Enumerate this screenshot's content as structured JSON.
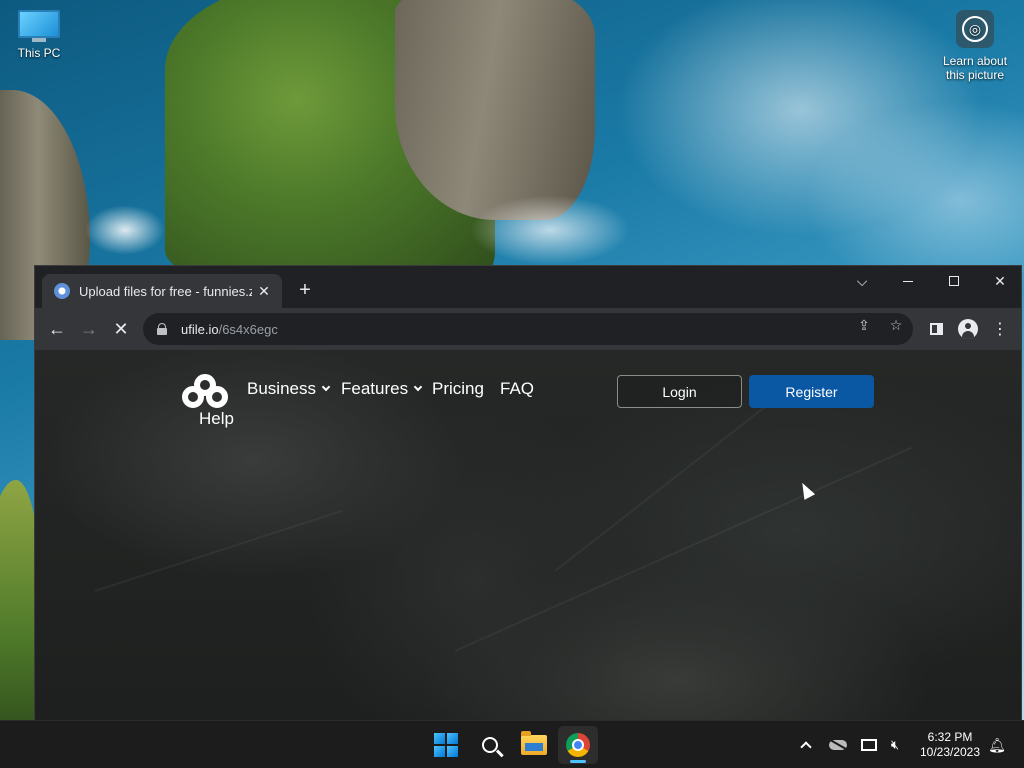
{
  "desktop": {
    "icons": [
      {
        "label": "This PC"
      },
      {
        "label": "Learn about this picture"
      }
    ]
  },
  "browser": {
    "tab": {
      "title": "Upload files for free - funnies.zip"
    },
    "address": {
      "host": "ufile.io",
      "path": "/6s4x6egc"
    }
  },
  "page": {
    "nav": {
      "business": "Business",
      "features": "Features",
      "pricing": "Pricing",
      "faq": "FAQ",
      "help": "Help"
    },
    "buttons": {
      "login": "Login",
      "register": "Register"
    }
  },
  "taskbar": {
    "clock": {
      "time": "6:32 PM",
      "date": "10/23/2023"
    }
  },
  "colors": {
    "register_bg": "#0a57a4",
    "browser_frame": "#202124",
    "toolbar": "#35363a",
    "taskbar": "#1c1c1c"
  }
}
